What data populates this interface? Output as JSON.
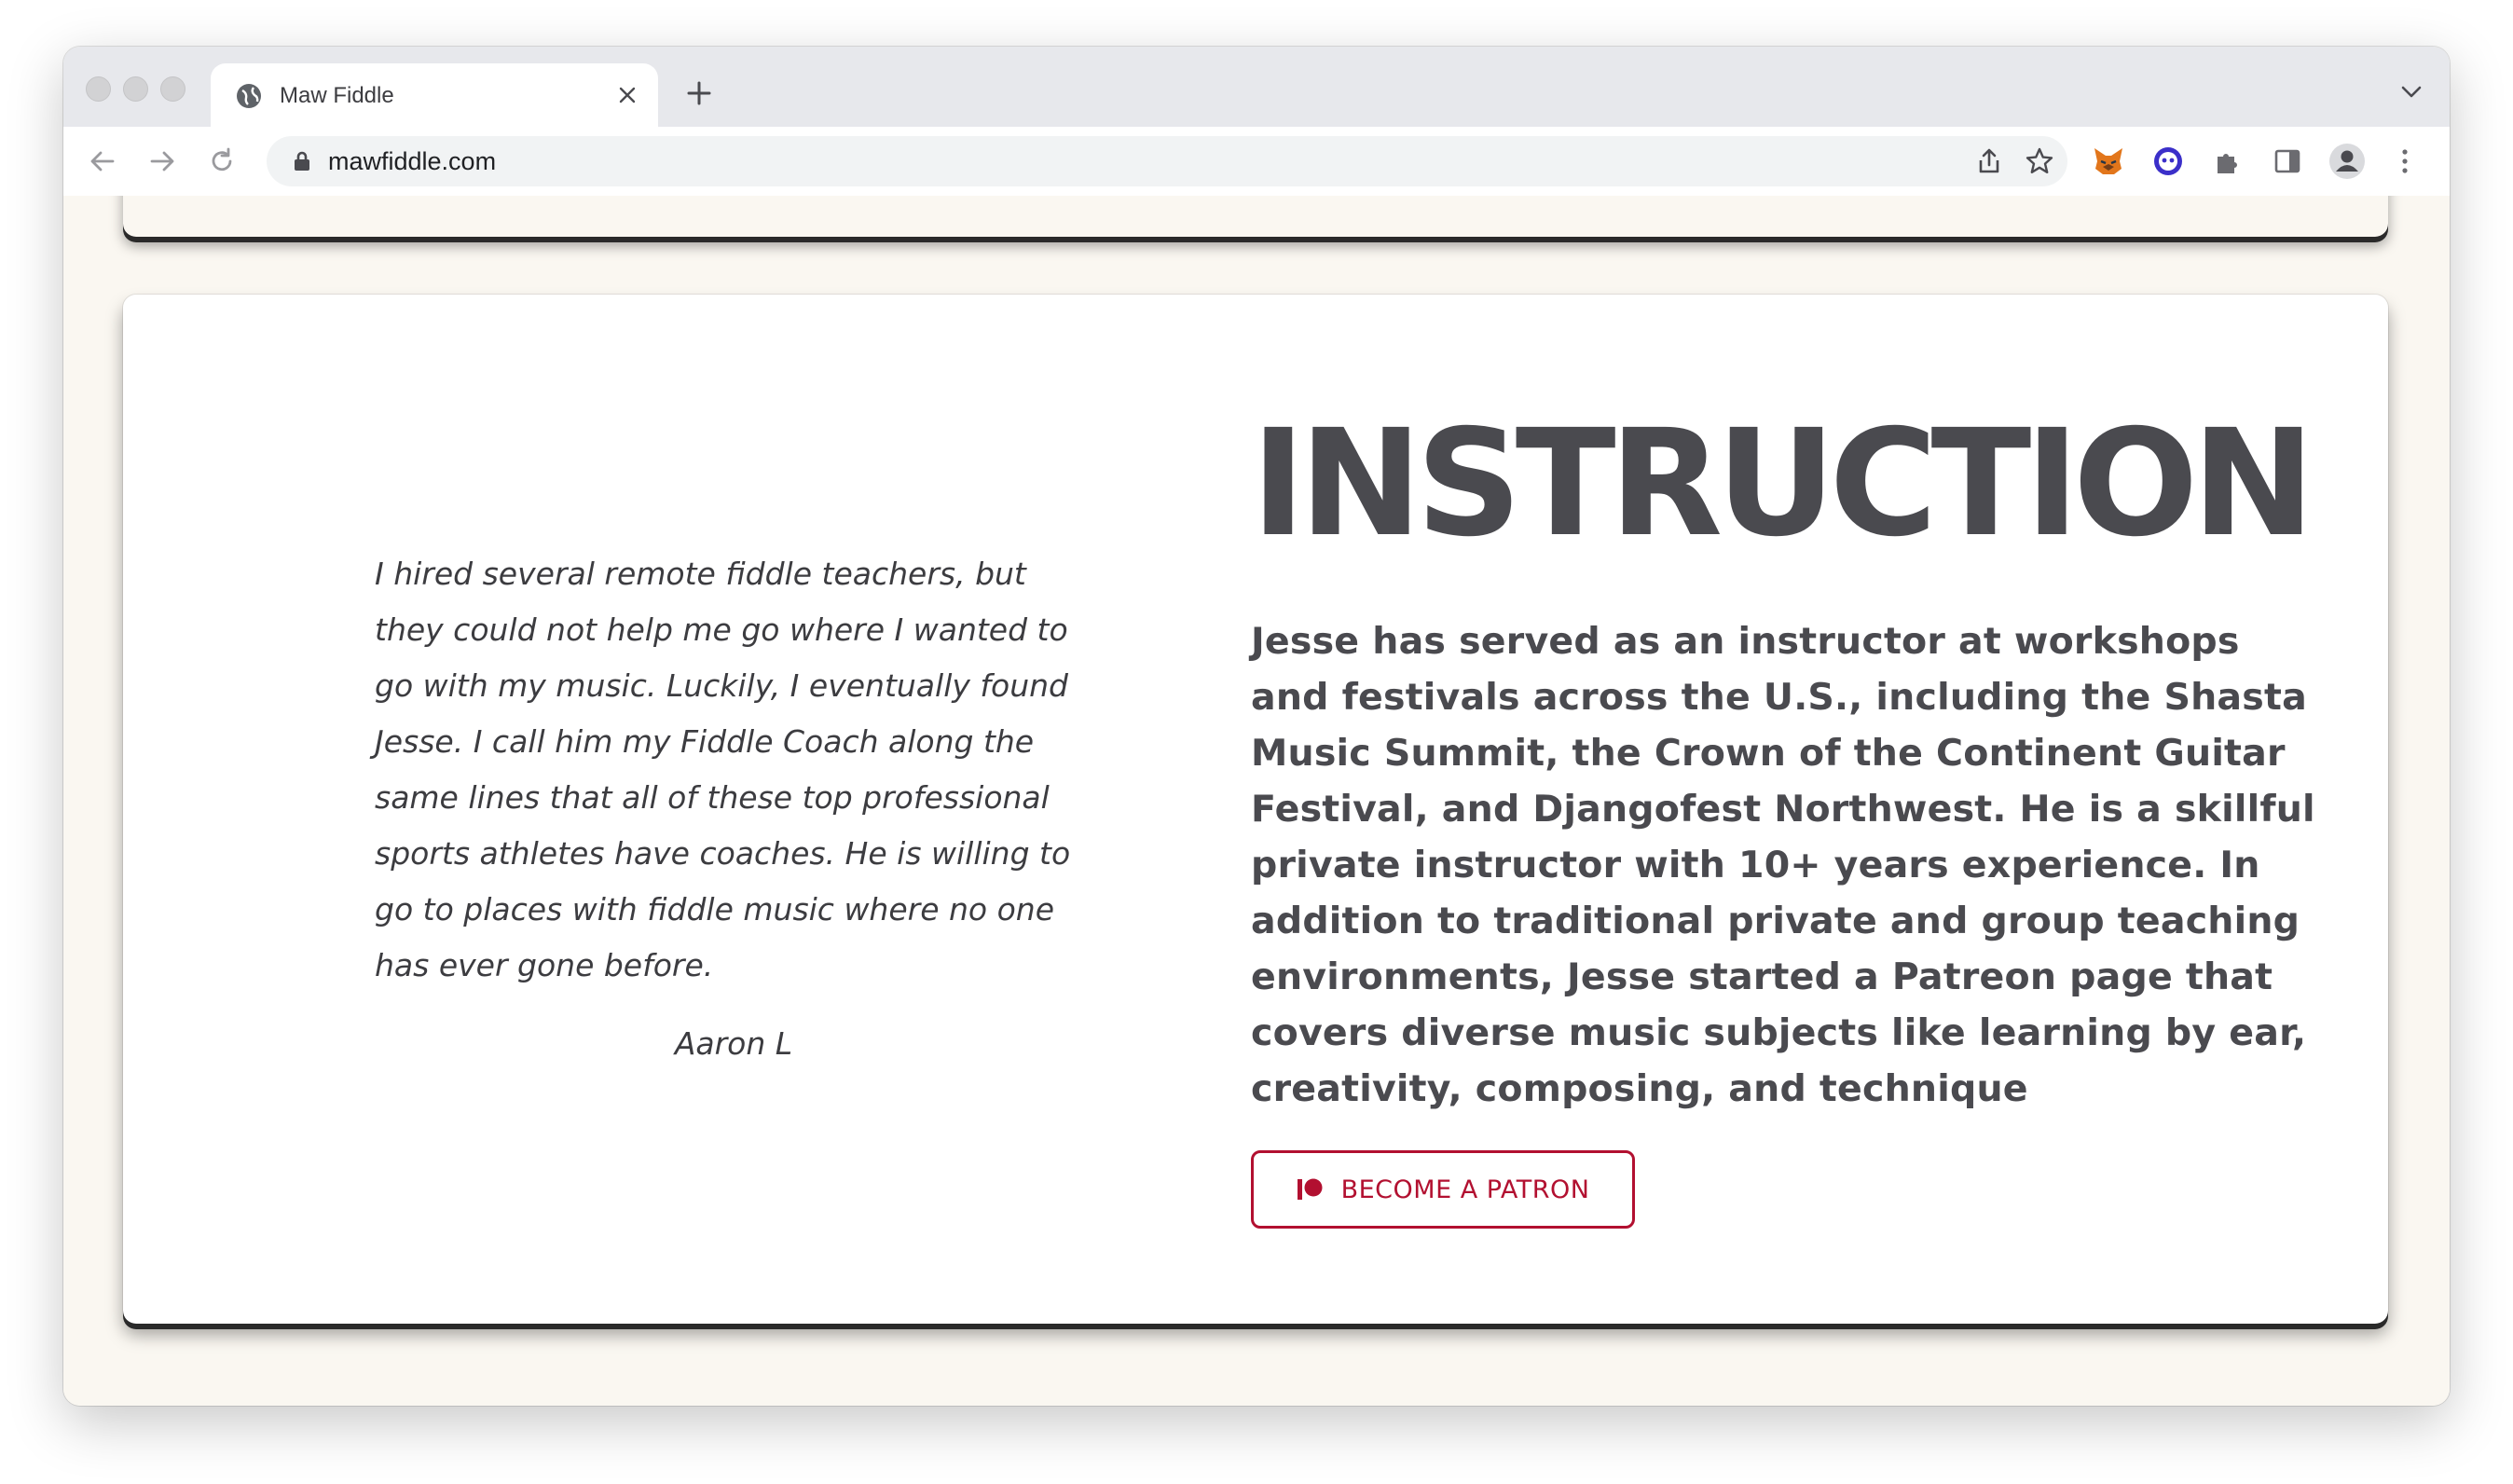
{
  "browser": {
    "tab": {
      "title": "Maw Fiddle"
    },
    "address_bar": {
      "url": "mawfiddle.com"
    }
  },
  "testimonial": {
    "quote": "I hired several remote fiddle teachers, but they could not help me go where I wanted to go with my music. Luckily, I eventually found Jesse. I call him my Fiddle Coach along the same lines that all of these top professional sports athletes have coaches. He is willing to go to places with fiddle music where no one has ever gone before.",
    "author": "Aaron L"
  },
  "instruction": {
    "heading": "INSTRUCTION",
    "body": "Jesse has served as an instructor at workshops and festivals across the U.S., including the Shasta Music Summit, the Crown of the Continent Guitar Festival, and Djangofest Northwest. He is a skillful private instructor with 10+ years experience. In addition to traditional private and group teaching environments, Jesse started a Patreon page that covers diverse music subjects like learning by ear, creativity, composing, and technique",
    "patron_button": {
      "label": "BECOME A PATRON",
      "icon": "patreon-icon",
      "color": "#b21030"
    }
  },
  "colors": {
    "page_background": "#faf7f1",
    "card_background": "#ffffff",
    "text": "#4a4a4f",
    "accent": "#b21030"
  }
}
